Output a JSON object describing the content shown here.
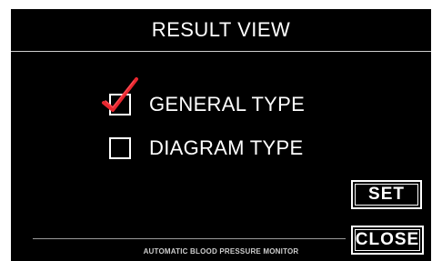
{
  "header": {
    "title": "RESULT VIEW"
  },
  "options": [
    {
      "label": "GENERAL TYPE",
      "checked": true
    },
    {
      "label": "DIAGRAM TYPE",
      "checked": false
    }
  ],
  "buttons": {
    "set_label": "SET",
    "close_label": "CLOSE"
  },
  "footer": {
    "text": "AUTOMATIC BLOOD PRESSURE MONITOR"
  },
  "colors": {
    "background": "#000000",
    "foreground": "#ffffff",
    "checkmark": "#e8272f"
  }
}
